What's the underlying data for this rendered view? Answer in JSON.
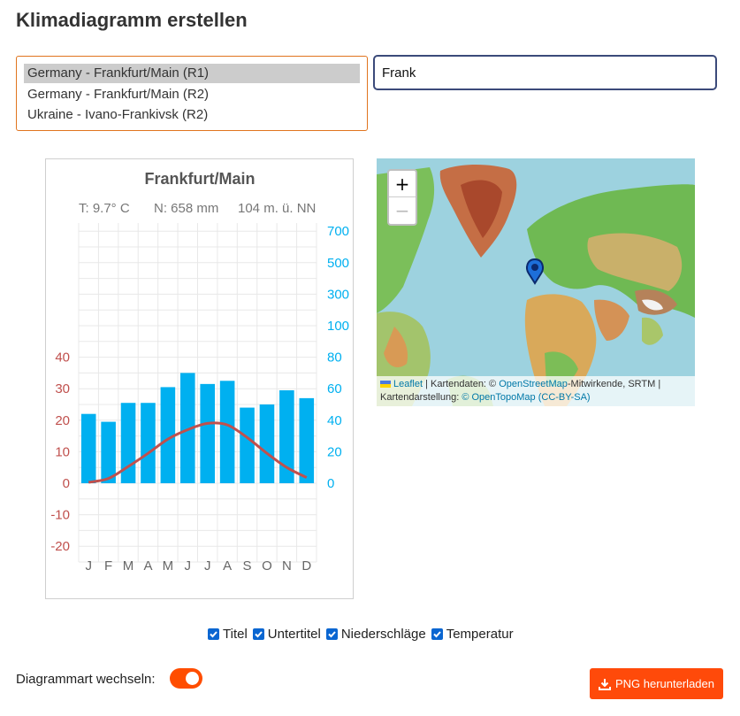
{
  "page": {
    "title": "Klimadiagramm erstellen"
  },
  "search": {
    "value": "Frank",
    "results": [
      {
        "label": "Germany - Frankfurt/Main (R1)",
        "selected": true
      },
      {
        "label": "Germany - Frankfurt/Main (R2)",
        "selected": false
      },
      {
        "label": "Ukraine - Ivano-Frankivsk (R2)",
        "selected": false
      }
    ]
  },
  "chart": {
    "title": "Frankfurt/Main",
    "subtitle": {
      "temp": "T: 9.7° C",
      "precip": "N: 658 mm",
      "elevation": "104 m. ü. NN"
    }
  },
  "chart_data": {
    "type": "bar",
    "categories": [
      "J",
      "F",
      "M",
      "A",
      "M",
      "J",
      "J",
      "A",
      "S",
      "O",
      "N",
      "D"
    ],
    "series": [
      {
        "type": "bar",
        "axis": "right",
        "values": [
          44,
          39,
          51,
          51,
          61,
          70,
          63,
          65,
          48,
          50,
          59,
          54
        ]
      },
      {
        "type": "line",
        "axis": "left",
        "values": [
          0.3,
          1.5,
          5.3,
          9.5,
          14.0,
          17.0,
          19.0,
          18.5,
          14.5,
          9.5,
          5.0,
          1.8
        ]
      }
    ],
    "left_axis": {
      "ticks": [
        -20,
        -10,
        0,
        10,
        20,
        30,
        40
      ],
      "range": [
        -20,
        40
      ],
      "color": "#c0504d"
    },
    "right_axis": {
      "ticks": [
        0,
        20,
        40,
        60,
        80,
        100,
        300,
        500,
        700
      ],
      "range": [
        0,
        80
      ],
      "color": "#00b0f0"
    },
    "bar_color": "#00b0f0",
    "line_color": "#c0504d",
    "grid": true
  },
  "map": {
    "zoom_in": "+",
    "zoom_out": "−",
    "attribution": {
      "leaflet": "Leaflet",
      "part1": " | Kartendaten: © ",
      "osm": "OpenStreetMap",
      "part2": "-Mitwirkende, SRTM | Kartendarstellung: ",
      "otm": "© OpenTopoMap (CC-BY-SA)"
    }
  },
  "options": {
    "titel": "Titel",
    "untertitel": "Untertitel",
    "niederschlaege": "Niederschläge",
    "temperatur": "Temperatur"
  },
  "switch": {
    "label": "Diagrammart wechseln:",
    "on": true
  },
  "download": {
    "label": "PNG herunterladen"
  },
  "colors": {
    "accent": "#ff4d00",
    "checkbox": "#0a66d1"
  }
}
